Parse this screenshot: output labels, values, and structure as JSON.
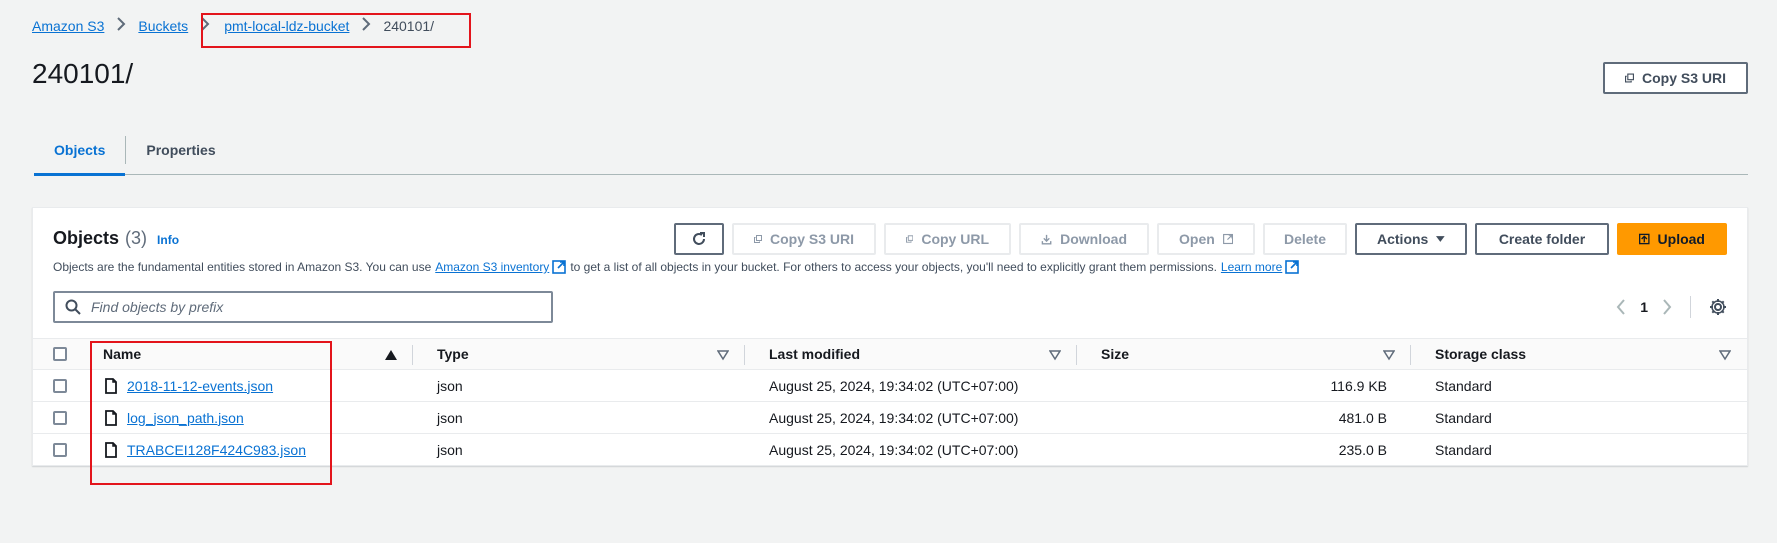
{
  "breadcrumb": {
    "items": [
      "Amazon S3",
      "Buckets",
      "pmt-local-ldz-bucket"
    ],
    "current": "240101/"
  },
  "page": {
    "title": "240101/",
    "copy_s3_uri": "Copy S3 URI"
  },
  "tabs": [
    {
      "label": "Objects",
      "active": true
    },
    {
      "label": "Properties",
      "active": false
    }
  ],
  "objects_panel": {
    "title": "Objects",
    "count": "(3)",
    "info": "Info",
    "description_before": "Objects are the fundamental entities stored in Amazon S3. You can use",
    "inventory_link": "Amazon S3 inventory",
    "description_middle": "to get a list of all objects in your bucket. For others to access your objects, you'll need to explicitly grant them permissions.",
    "learn_more": "Learn more",
    "toolbar": {
      "copy_s3_uri": "Copy S3 URI",
      "copy_url": "Copy URL",
      "download": "Download",
      "open": "Open",
      "delete": "Delete",
      "actions": "Actions",
      "create_folder": "Create folder",
      "upload": "Upload"
    },
    "search": {
      "placeholder": "Find objects by prefix",
      "value": ""
    },
    "pagination": {
      "current_page": "1"
    }
  },
  "table": {
    "columns": [
      "Name",
      "Type",
      "Last modified",
      "Size",
      "Storage class"
    ],
    "rows": [
      {
        "name": "2018-11-12-events.json",
        "type": "json",
        "last_modified": "August 25, 2024, 19:34:02 (UTC+07:00)",
        "size": "116.9 KB",
        "storage_class": "Standard"
      },
      {
        "name": "log_json_path.json",
        "type": "json",
        "last_modified": "August 25, 2024, 19:34:02 (UTC+07:00)",
        "size": "481.0 B",
        "storage_class": "Standard"
      },
      {
        "name": "TRABCEI128F424C983.json",
        "type": "json",
        "last_modified": "August 25, 2024, 19:34:02 (UTC+07:00)",
        "size": "235.0 B",
        "storage_class": "Standard"
      }
    ]
  },
  "colors": {
    "link": "#0972d3",
    "primary": "#ff9900",
    "highlight": "#e3141b",
    "background": "#f2f3f3"
  },
  "icons": [
    "chevron-right-icon",
    "copy-icon",
    "refresh-icon",
    "download-icon",
    "external-link-icon",
    "caret-down-icon",
    "search-icon",
    "chevron-left-icon",
    "settings-icon",
    "file-icon",
    "sort-ascending-icon",
    "sort-descending-icon",
    "upload-icon"
  ]
}
